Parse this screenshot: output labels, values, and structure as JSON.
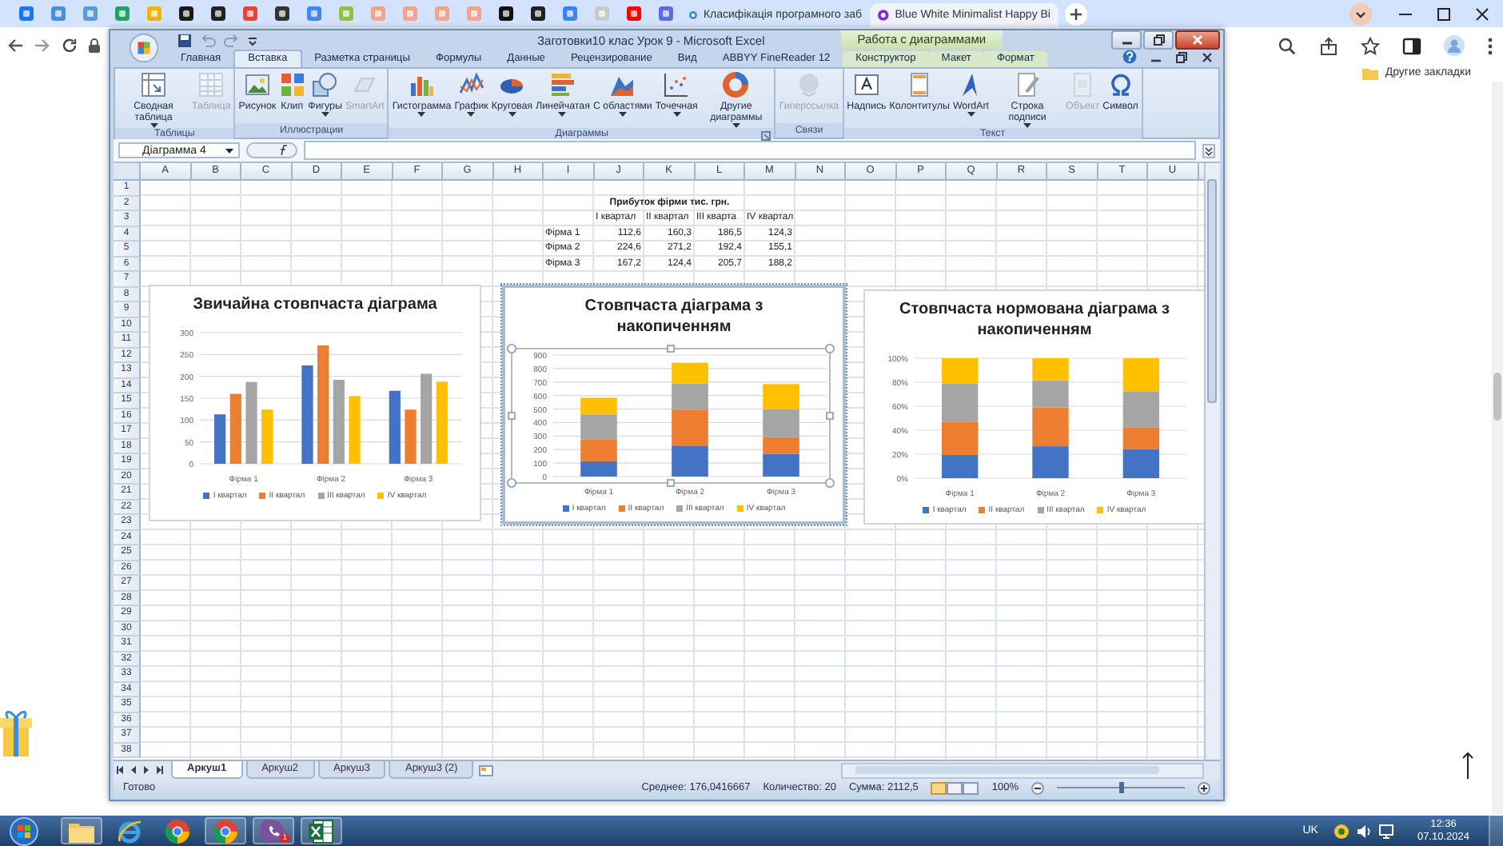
{
  "browser": {
    "tabs": [
      {
        "title": "Класифікація програмного заб",
        "selected": false
      },
      {
        "title": "Blue White Minimalist Happy Bi",
        "selected": true
      }
    ],
    "bookmarks_folder": "Другие закладки"
  },
  "excel": {
    "title": "Заготовки10 клас Урок 9 - Microsoft Excel",
    "context_title": "Работа с диаграммами",
    "ribbon_tabs": [
      {
        "label": "Главная",
        "selected": false,
        "kind": "normal"
      },
      {
        "label": "Вставка",
        "selected": true,
        "kind": "normal"
      },
      {
        "label": "Разметка страницы",
        "selected": false,
        "kind": "normal"
      },
      {
        "label": "Формулы",
        "selected": false,
        "kind": "normal"
      },
      {
        "label": "Данные",
        "selected": false,
        "kind": "normal"
      },
      {
        "label": "Рецензирование",
        "selected": false,
        "kind": "normal"
      },
      {
        "label": "Вид",
        "selected": false,
        "kind": "normal"
      },
      {
        "label": "ABBYY FineReader 12",
        "selected": false,
        "kind": "normal"
      },
      {
        "label": "Конструктор",
        "selected": false,
        "kind": "context"
      },
      {
        "label": "Макет",
        "selected": false,
        "kind": "context"
      },
      {
        "label": "Формат",
        "selected": false,
        "kind": "context"
      }
    ],
    "ribbon_groups": [
      {
        "name": "Таблицы",
        "launcher": false,
        "buttons": [
          {
            "label": "Сводная таблица",
            "disabled": false,
            "dropdown": true
          },
          {
            "label": "Таблица",
            "disabled": true,
            "dropdown": false
          }
        ]
      },
      {
        "name": "Иллюстрации",
        "launcher": false,
        "buttons": [
          {
            "label": "Рисунок",
            "disabled": false,
            "dropdown": false
          },
          {
            "label": "Клип",
            "disabled": false,
            "dropdown": false
          },
          {
            "label": "Фигуры",
            "disabled": false,
            "dropdown": true
          },
          {
            "label": "SmartArt",
            "disabled": true,
            "dropdown": false
          }
        ]
      },
      {
        "name": "Диаграммы",
        "launcher": true,
        "buttons": [
          {
            "label": "Гистограмма",
            "disabled": false,
            "dropdown": true
          },
          {
            "label": "График",
            "disabled": false,
            "dropdown": true
          },
          {
            "label": "Круговая",
            "disabled": false,
            "dropdown": true
          },
          {
            "label": "Линейчатая",
            "disabled": false,
            "dropdown": true
          },
          {
            "label": "С областями",
            "disabled": false,
            "dropdown": true
          },
          {
            "label": "Точечная",
            "disabled": false,
            "dropdown": true
          },
          {
            "label": "Другие диаграммы",
            "disabled": false,
            "dropdown": true
          }
        ]
      },
      {
        "name": "Связи",
        "launcher": false,
        "buttons": [
          {
            "label": "Гиперссылка",
            "disabled": true,
            "dropdown": false
          }
        ]
      },
      {
        "name": "Текст",
        "launcher": false,
        "buttons": [
          {
            "label": "Надпись",
            "disabled": false,
            "dropdown": false
          },
          {
            "label": "Колонтитулы",
            "disabled": false,
            "dropdown": false
          },
          {
            "label": "WordArt",
            "disabled": false,
            "dropdown": true
          },
          {
            "label": "Строка подписи",
            "disabled": false,
            "dropdown": true
          },
          {
            "label": "Объект",
            "disabled": true,
            "dropdown": false
          },
          {
            "label": "Символ",
            "disabled": false,
            "dropdown": false
          }
        ]
      }
    ],
    "name_box": "Діаграмма 4",
    "columns": [
      "A",
      "B",
      "C",
      "D",
      "E",
      "F",
      "G",
      "H",
      "I",
      "J",
      "K",
      "L",
      "M",
      "N",
      "O",
      "P",
      "Q",
      "R",
      "S",
      "T",
      "U"
    ],
    "rows": [
      "1",
      "2",
      "3",
      "4",
      "5",
      "6",
      "7",
      "8",
      "9",
      "10",
      "11",
      "12",
      "13",
      "14",
      "15",
      "16",
      "17",
      "18",
      "19",
      "20",
      "21",
      "22",
      "23",
      "24",
      "25",
      "26",
      "27",
      "28",
      "29",
      "30",
      "31",
      "32",
      "33",
      "34",
      "35",
      "36",
      "37",
      "38"
    ],
    "table": {
      "title": "Прибуток фірми тис. грн.",
      "headers": [
        "I квартал",
        "II квартал",
        "III кварта",
        "IV квартал"
      ],
      "rows": [
        {
          "label": "Фірма 1",
          "values": [
            "112,6",
            "160,3",
            "186,5",
            "124,3"
          ]
        },
        {
          "label": "Фірма 2",
          "values": [
            "224,6",
            "271,2",
            "192,4",
            "155,1"
          ]
        },
        {
          "label": "Фірма 3",
          "values": [
            "167,2",
            "124,4",
            "205,7",
            "188,2"
          ]
        }
      ]
    },
    "charts": [
      {
        "selected": false,
        "chart_data": {
          "type": "bar",
          "title": "Звичайна стовпчаста діаграма",
          "categories": [
            "Фірма 1",
            "Фірма 2",
            "Фірма 3"
          ],
          "series": [
            {
              "name": "I квартал",
              "color": "#4472c4",
              "values": [
                113,
                225,
                167
              ]
            },
            {
              "name": "II квартал",
              "color": "#ed7d31",
              "values": [
                160,
                271,
                124
              ]
            },
            {
              "name": "III квартал",
              "color": "#a5a5a5",
              "values": [
                187,
                192,
                206
              ]
            },
            {
              "name": "IV квартал",
              "color": "#ffc000",
              "values": [
                124,
                155,
                188
              ]
            }
          ],
          "grid": true,
          "ylim": [
            0,
            300
          ],
          "yticks": [
            0,
            50,
            100,
            150,
            200,
            250,
            300
          ]
        }
      },
      {
        "selected": true,
        "chart_data": {
          "type": "bar",
          "title": "Стовпчаста діаграма з накопиченням",
          "categories": [
            "Фірма 1",
            "Фірма 2",
            "Фірма 3"
          ],
          "stacked": true,
          "series": [
            {
              "name": "I квартал",
              "color": "#4472c4",
              "values": [
                113,
                225,
                167
              ]
            },
            {
              "name": "II квартал",
              "color": "#ed7d31",
              "values": [
                160,
                271,
                124
              ]
            },
            {
              "name": "III квартал",
              "color": "#a5a5a5",
              "values": [
                187,
                192,
                206
              ]
            },
            {
              "name": "IV квартал",
              "color": "#ffc000",
              "values": [
                124,
                155,
                188
              ]
            }
          ],
          "grid": true,
          "ylim": [
            0,
            900
          ],
          "yticks": [
            0,
            100,
            200,
            300,
            400,
            500,
            600,
            700,
            800,
            900
          ]
        }
      },
      {
        "selected": false,
        "chart_data": {
          "type": "bar",
          "title": "Стовпчаста нормована діаграма з накопиченням",
          "categories": [
            "Фірма 1",
            "Фірма 2",
            "Фірма 3"
          ],
          "stacked": true,
          "series": [
            {
              "name": "I квартал",
              "color": "#4472c4",
              "values": [
                0.193,
                0.266,
                0.244
              ]
            },
            {
              "name": "II квартал",
              "color": "#ed7d31",
              "values": [
                0.275,
                0.322,
                0.181
              ]
            },
            {
              "name": "III квартал",
              "color": "#a5a5a5",
              "values": [
                0.319,
                0.228,
                0.3
              ]
            },
            {
              "name": "IV квартал",
              "color": "#ffc000",
              "values": [
                0.213,
                0.184,
                0.275
              ]
            }
          ],
          "grid": true,
          "ylim": [
            0,
            1
          ],
          "yticks": [
            {
              "value": 0,
              "label": "0%"
            },
            {
              "value": 0.2,
              "label": "20%"
            },
            {
              "value": 0.4,
              "label": "40%"
            },
            {
              "value": 0.6,
              "label": "60%"
            },
            {
              "value": 0.8,
              "label": "80%"
            },
            {
              "value": 1,
              "label": "100%"
            }
          ]
        }
      }
    ],
    "sheet_tabs": [
      {
        "label": "Аркуш1",
        "selected": true
      },
      {
        "label": "Аркуш2",
        "selected": false
      },
      {
        "label": "Аркуш3",
        "selected": false
      },
      {
        "label": "Аркуш3 (2)",
        "selected": false
      }
    ],
    "status_bar": {
      "state": "Готово",
      "average": "Среднее: 176,0416667",
      "count": "Количество: 20",
      "sum": "Сумма: 2112,5",
      "zoom": "100%",
      "zoom_slider": {
        "level": 0.5
      }
    }
  },
  "taskbar": {
    "apps": [
      {
        "kind": "folder",
        "open": true
      },
      {
        "kind": "ie",
        "open": false
      },
      {
        "kind": "chrome",
        "open": false
      },
      {
        "kind": "chrome",
        "open": true
      },
      {
        "kind": "viber",
        "open": true,
        "badge": "1"
      },
      {
        "kind": "excel",
        "open": true
      }
    ],
    "language": "UK",
    "time": "12:36",
    "date": "07.10.2024"
  }
}
